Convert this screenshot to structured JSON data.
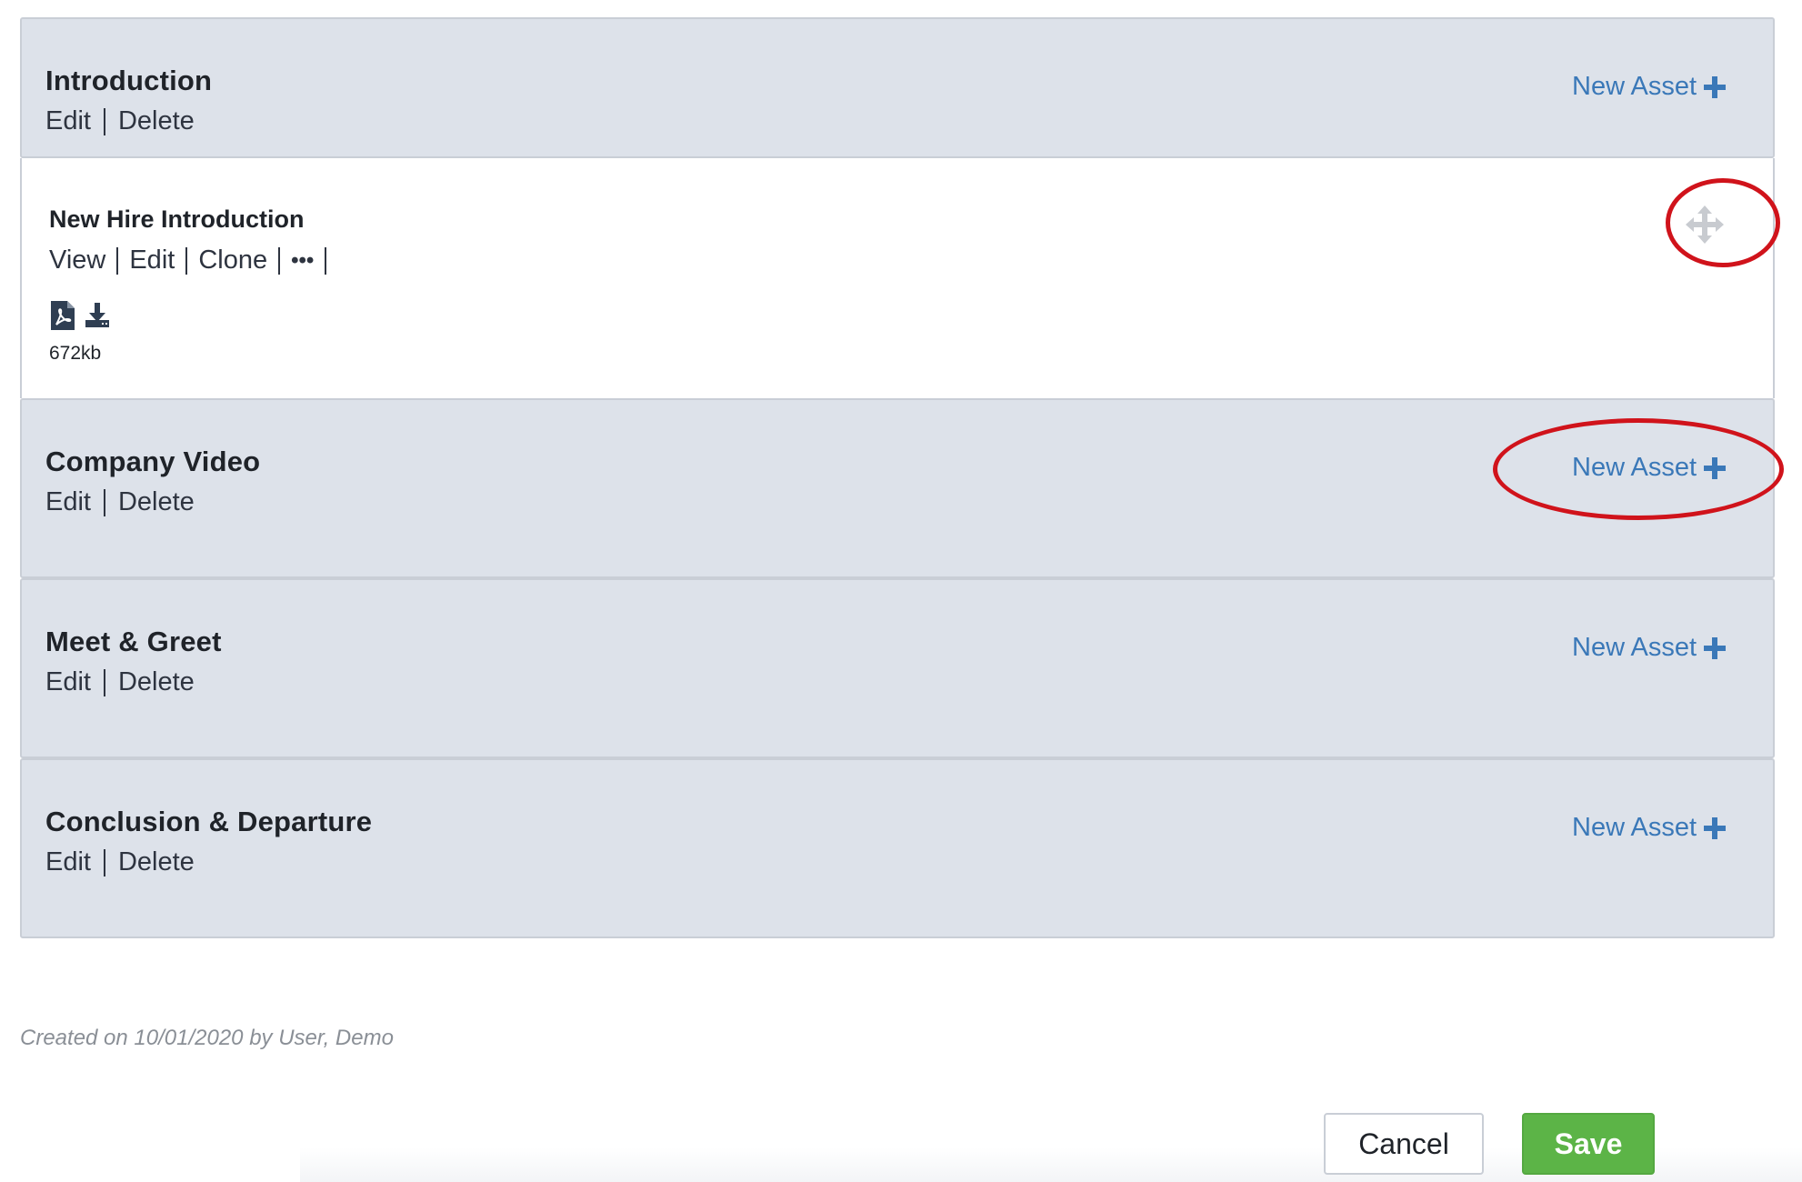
{
  "sections": [
    {
      "title": "Introduction",
      "edit_label": "Edit",
      "delete_label": "Delete",
      "new_asset_label": "New Asset"
    },
    {
      "title": "Company Video",
      "edit_label": "Edit",
      "delete_label": "Delete",
      "new_asset_label": "New Asset"
    },
    {
      "title": "Meet & Greet",
      "edit_label": "Edit",
      "delete_label": "Delete",
      "new_asset_label": "New Asset"
    },
    {
      "title": "Conclusion & Departure",
      "edit_label": "Edit",
      "delete_label": "Delete",
      "new_asset_label": "New Asset"
    }
  ],
  "asset": {
    "title": "New Hire Introduction",
    "view_label": "View",
    "edit_label": "Edit",
    "clone_label": "Clone",
    "more_label": "•••",
    "file_icon": "pdf-file-icon",
    "download_icon": "download-icon",
    "size": "672kb",
    "move_icon": "move-arrows-icon"
  },
  "footer": {
    "created_text": "Created on 10/01/2020 by User, Demo",
    "cancel_label": "Cancel",
    "save_label": "Save"
  },
  "colors": {
    "section_bg": "#dde2ea",
    "link_blue": "#3a78b8",
    "save_green": "#5cb447",
    "annotation_red": "#d0131b"
  }
}
